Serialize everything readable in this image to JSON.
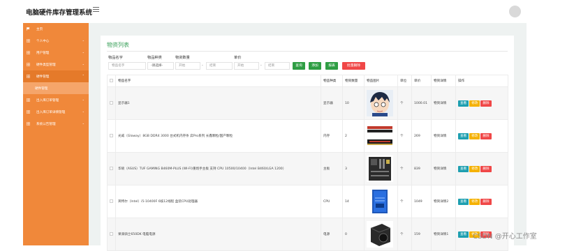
{
  "header": {
    "app_title": "电脑硬件库存管理系统",
    "avatar_text": "avatar"
  },
  "sidebar": {
    "items": [
      {
        "label": "主页",
        "icon": "flag-icon"
      },
      {
        "label": "个人中心",
        "icon": "grid-icon"
      },
      {
        "label": "用户管理",
        "icon": "grid-icon"
      },
      {
        "label": "硬件类型管理",
        "icon": "grid-icon"
      },
      {
        "label": "硬件管理",
        "icon": "grid-icon"
      },
      {
        "label": "出入库订单管理",
        "icon": "grid-icon"
      },
      {
        "label": "出入库订单详情管理",
        "icon": "grid-icon"
      },
      {
        "label": "系统公告管理",
        "icon": "grid-icon"
      }
    ],
    "sub_item": "硬件管理"
  },
  "panel": {
    "title": "物资列表"
  },
  "filters": {
    "name_label": "物品名字",
    "name_placeholder": "物品名字",
    "type_label": "物品种类",
    "type_value": "-请选择-",
    "qty_label": "物资数量",
    "qty_start": "开始",
    "qty_end": "结束",
    "price_label": "单价",
    "price_start": "开始",
    "price_end": "结束",
    "dash": "-"
  },
  "buttons": {
    "search": "查询",
    "add": "添加",
    "report": "报表",
    "batch_delete": "批量删除"
  },
  "colors": {
    "sidebar": "#f0883a",
    "accent_green": "#3aa05a",
    "btn_green": "#2f9e44",
    "btn_red": "#f04747",
    "op_view": "#1e9fb0",
    "op_edit": "#f5b100",
    "op_delete": "#f04747"
  },
  "table": {
    "headers": [
      "物品名字",
      "物品种类",
      "物资数量",
      "物品图片",
      "单位",
      "单价",
      "物资详情",
      "操作"
    ],
    "ops": {
      "view": "查看",
      "edit": "修改",
      "delete": "删除"
    },
    "rows": [
      {
        "name": "显示器1",
        "type": "显示器",
        "qty": "10",
        "unit": "个",
        "price": "1000.01",
        "detail": "物资详情",
        "image": "anime-avatar-image"
      },
      {
        "name": "光威（Gloway）8GB DDR4 3000 台式机内存条 弈Pro系列 长鑫颗粒/国产颗粒",
        "type": "内存",
        "qty": "2",
        "unit": "个",
        "price": "269",
        "detail": "物资详情",
        "image": "ram-stick-image"
      },
      {
        "name": "华硕（ASUS）TUF GAMING B460M-PLUS (WI-FI)重炮手主板 支持 CPU 10500/10400（Intel B460/LGA 1200）",
        "type": "主板",
        "qty": "3",
        "unit": "个",
        "price": "839",
        "detail": "物资详情",
        "image": "motherboard-image"
      },
      {
        "name": "英特尔（Intel）i5-10400F 6核12线程 盒装CPU处理器",
        "type": "CPU",
        "qty": "14",
        "unit": "个",
        "price": "1049",
        "detail": "物资详情2",
        "image": "cpu-box-image"
      },
      {
        "name": "果骑骑士650DK 电脑电源",
        "type": "电源",
        "qty": "0",
        "unit": "个",
        "price": "159",
        "detail": "物资详情1",
        "image": "power-supply-image"
      }
    ]
  },
  "watermark": "CSDN @开心工作室"
}
